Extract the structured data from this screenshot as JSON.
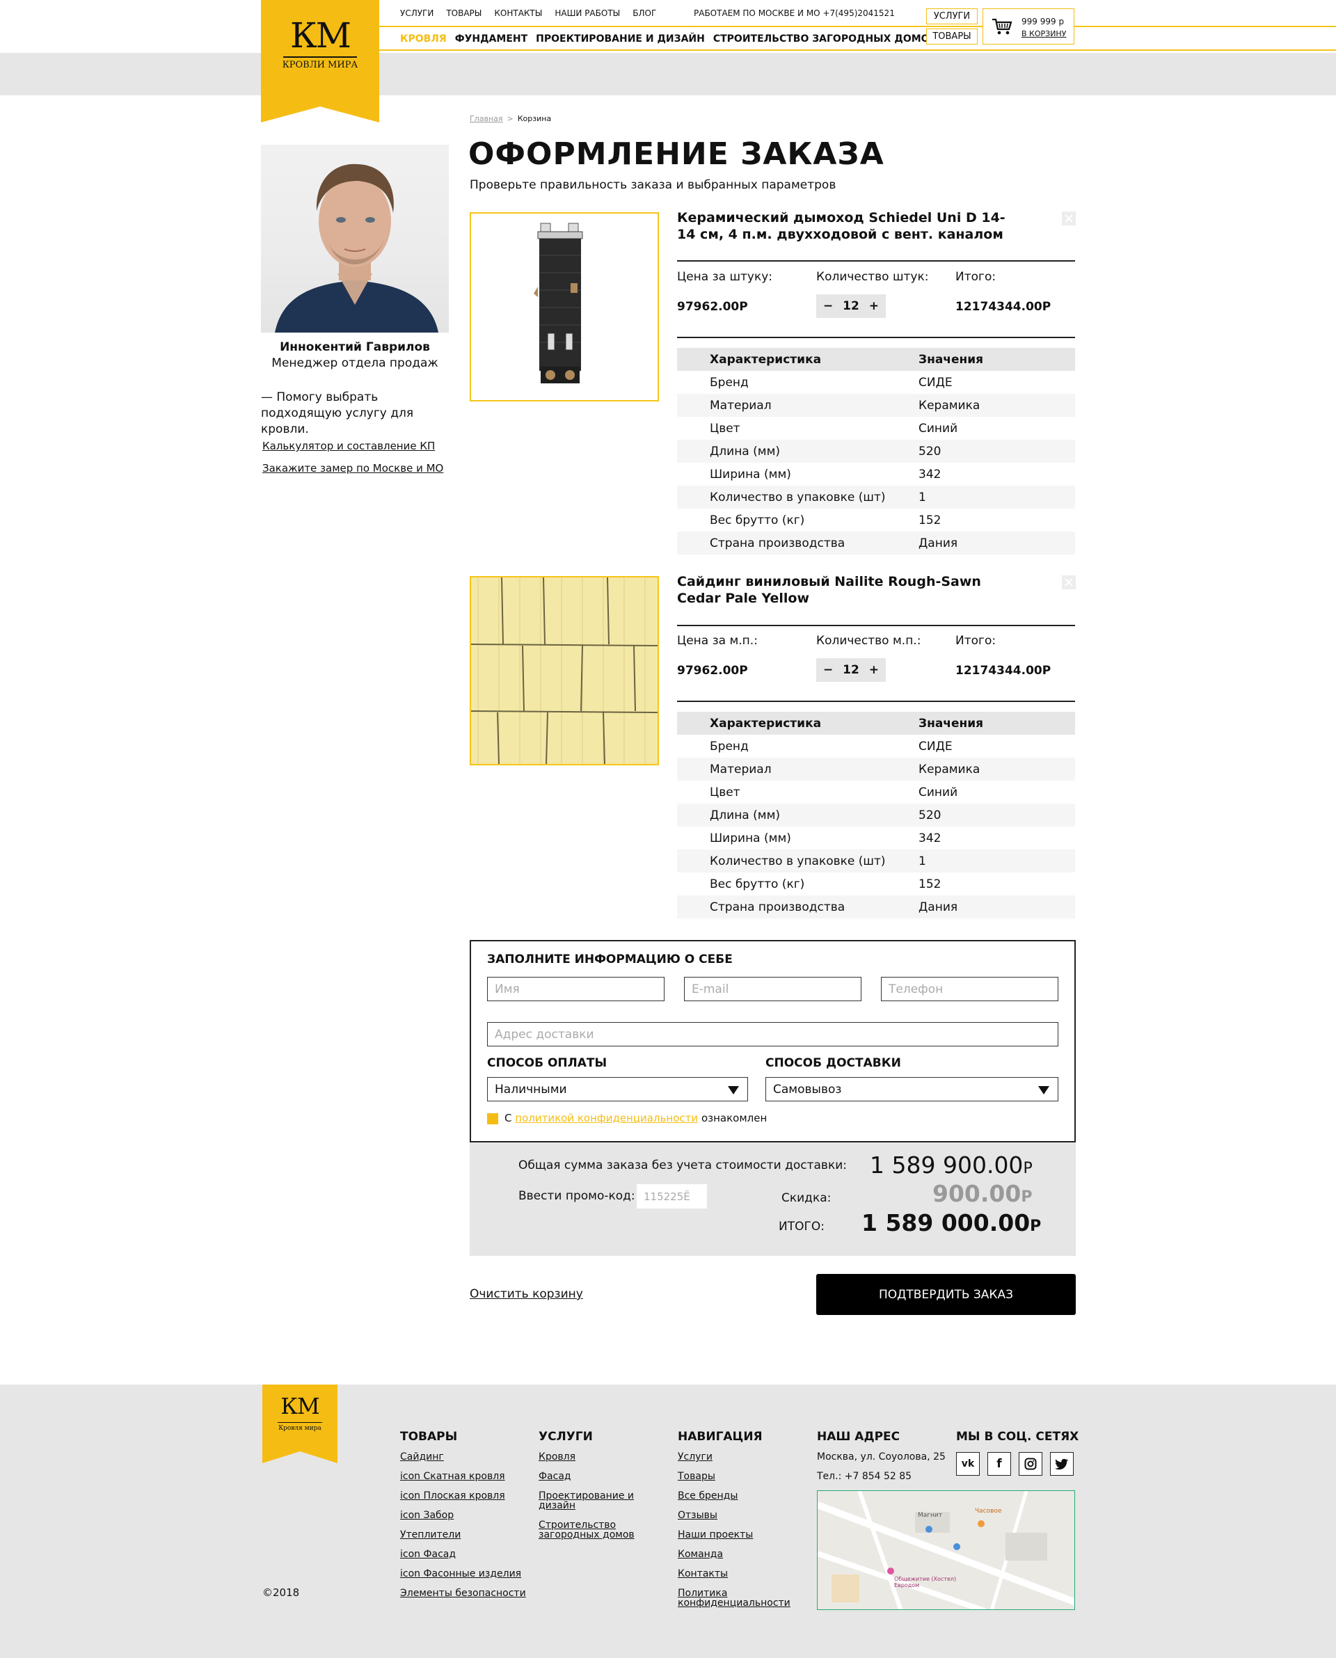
{
  "header": {
    "logo": {
      "letters": "КМ",
      "name": "КРОВЛИ МИРА"
    },
    "top_nav": [
      "УСЛУГИ",
      "ТОВАРЫ",
      "КОНТАКТЫ",
      "НАШИ РАБОТЫ",
      "БЛОГ"
    ],
    "work_hours": "РАБОТАЕМ ПО МОСКВЕ И МО +7(495)2041521",
    "main_nav": [
      "КРОВЛЯ",
      "ФУНДАМЕНТ",
      "ПРОЕКТИРОВАНИЕ И ДИЗАЙН",
      "СТРОИТЕЛЬСТВО ЗАГОРОДНЫХ ДОМОВ"
    ],
    "btn_services": "УСЛУГИ",
    "btn_goods": "ТОВАРЫ",
    "cart": {
      "amount": "999 999 р",
      "link": "В КОРЗИНУ",
      "icon": "basket-icon"
    }
  },
  "breadcrumb": {
    "home": "Главная",
    "sep": ">",
    "current": "Корзина"
  },
  "page": {
    "title": "ОФОРМЛЕНИЕ ЗАКАЗА",
    "subtitle": "Проверьте правильность заказа и выбранных параметров"
  },
  "manager": {
    "name": "Иннокентий Гаврилов",
    "role": "Менеджер отдела продаж",
    "quote": "— Помогу выбрать подходящую услугу для кровли.",
    "link1": "Калькулятор и составление КП",
    "link2": "Закажите замер по Москве и МО"
  },
  "products": [
    {
      "name": "Керамический дымоход Schiedel Uni D 14-14 см, 4 п.м. двухходовой с вент. каналом",
      "price_label": "Цена за штуку:",
      "qty_label": "Количество штук:",
      "total_label": "Итого:",
      "price": "97962.00Р",
      "qty": "12",
      "total": "12174344.00Р",
      "spec_head": [
        "Характеристика",
        "Значения"
      ],
      "specs": [
        [
          "Бренд",
          "СИДЕ"
        ],
        [
          "Материал",
          "Керамика"
        ],
        [
          "Цвет",
          "Синий"
        ],
        [
          "Длина (мм)",
          "520"
        ],
        [
          "Ширина (мм)",
          "342"
        ],
        [
          "Количество в упаковке (шт)",
          "1"
        ],
        [
          "Вес брутто (кг)",
          "152"
        ],
        [
          "Страна производства",
          "Дания"
        ]
      ]
    },
    {
      "name": "Сайдинг виниловый Nailite Rough-Sawn Cedar Pale Yellow",
      "price_label": "Цена за м.п.:",
      "qty_label": "Количество м.п.:",
      "total_label": "Итого:",
      "price": "97962.00Р",
      "qty": "12",
      "total": "12174344.00Р",
      "spec_head": [
        "Характеристика",
        "Значения"
      ],
      "specs": [
        [
          "Бренд",
          "СИДЕ"
        ],
        [
          "Материал",
          "Керамика"
        ],
        [
          "Цвет",
          "Синий"
        ],
        [
          "Длина (мм)",
          "520"
        ],
        [
          "Ширина (мм)",
          "342"
        ],
        [
          "Количество в упаковке (шт)",
          "1"
        ],
        [
          "Вес брутто (кг)",
          "152"
        ],
        [
          "Страна производства",
          "Дания"
        ]
      ]
    }
  ],
  "form": {
    "title": "ЗАПОЛНИТЕ ИНФОРМАЦИЮ О СЕБЕ",
    "name_ph": "Имя",
    "email_ph": "E-mail",
    "phone_ph": "Телефон",
    "address_ph": "Адрес доставки",
    "payment_label": "СПОСОБ ОПЛАТЫ",
    "payment_value": "Наличными",
    "delivery_label": "СПОСОБ ДОСТАВКИ",
    "delivery_value": "Самовывоз",
    "policy_pre": "С",
    "policy_link": "политикой конфиденциальности",
    "policy_post": "ознакомлен"
  },
  "totals": {
    "sum_label": "Общая сумма заказа без учета стоимости доставки:",
    "sum_value": "1 589 900.00",
    "promo_label": "Ввести промо-код:",
    "promo_value": "115225Ё",
    "discount_label": "Скидка:",
    "discount_value": "900.00",
    "total_label": "ИТОГО:",
    "total_value": "1 589 000.00",
    "currency": "Р"
  },
  "actions": {
    "clear": "Очистить корзину",
    "confirm": "ПОДТВЕРДИТЬ ЗАКАЗ"
  },
  "footer": {
    "logo": {
      "letters": "КМ",
      "name": "Кровля мира"
    },
    "goods_title": "ТОВАРЫ",
    "goods": [
      "Сайдинг",
      "icon Скатная кровля",
      "icon Плоская кровля",
      "icon Забор",
      "Утеплители",
      "icon Фасад",
      "icon Фасонные изделия",
      "Элементы безопасности"
    ],
    "services_title": "УСЛУГИ",
    "services": [
      "Кровля",
      "Фасад",
      "Проектирование и дизайн",
      "Строительство загородных домов"
    ],
    "nav_title": "НАВИГАЦИЯ",
    "nav": [
      "Услуги",
      "Товары",
      "Все бренды",
      "Отзывы",
      "Наши проекты",
      "Команда",
      "Контакты",
      "Политика конфиденциальности"
    ],
    "address_title": "НАШ АДРЕС",
    "address": "Москва, ул. Соуолова, 25",
    "phone": "Тел.: +7 854 52 85",
    "social_title": "МЫ В СОЦ. СЕТЯХ",
    "social": [
      "vk-icon",
      "facebook-icon",
      "instagram-icon",
      "twitter-icon"
    ],
    "map_labels": [
      "Магнит",
      "Часовое",
      "Общежитие (Хостел) Евродом"
    ],
    "copyright": "©2018"
  },
  "colors": {
    "accent": "#f5bd13",
    "gray": "#e6e6e6",
    "dark": "#000000"
  }
}
